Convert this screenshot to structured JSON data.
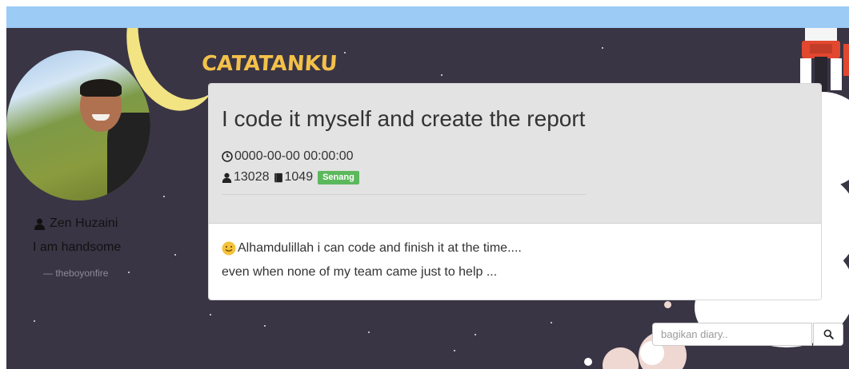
{
  "app": {
    "logo_text": "CATATANKU"
  },
  "profile": {
    "name": "Zen Huzaini",
    "bio": "I am handsome",
    "handle": "— theboyonfire",
    "icon": "user-icon"
  },
  "post": {
    "title": "I code it myself and create the report",
    "datetime": "0000-00-00 00:00:00",
    "views": "13028",
    "count": "1049",
    "mood_badge": "Senang",
    "mood_color": "#5cb85c",
    "body_lines": [
      "Alhamdulillah i can code and finish it at the time....",
      "even when none of my team came just to help ..."
    ]
  },
  "search": {
    "placeholder": "bagikan diary..",
    "icon": "search-icon"
  },
  "colors": {
    "topbar": "#9ccbf5",
    "background": "#3a3545",
    "logo": "#f3c14a",
    "moon": "#f2e383"
  }
}
